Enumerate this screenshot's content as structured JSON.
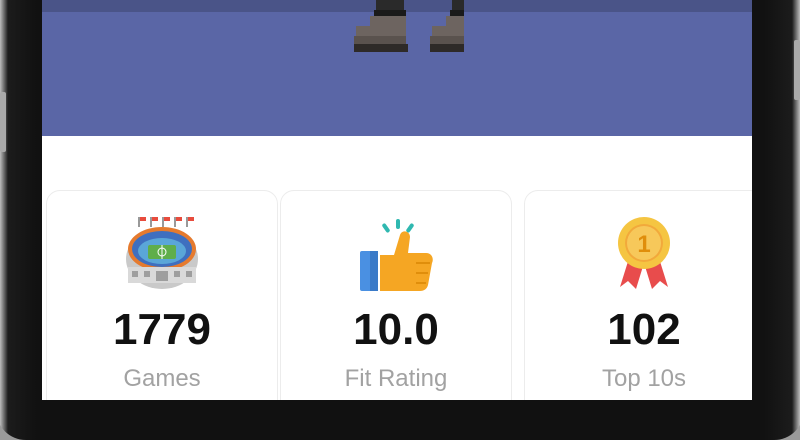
{
  "stats": [
    {
      "value": "1779",
      "label": "Games",
      "icon": "stadium-icon"
    },
    {
      "value": "10.0",
      "label": "Fit Rating",
      "icon": "thumbs-up-icon"
    },
    {
      "value": "102",
      "label": "Top 10s",
      "icon": "medal-icon"
    }
  ],
  "colors": {
    "hero_background": "#5a66a6",
    "card_border": "#ececec",
    "value_text": "#111111",
    "label_text": "#a2a2a2"
  }
}
